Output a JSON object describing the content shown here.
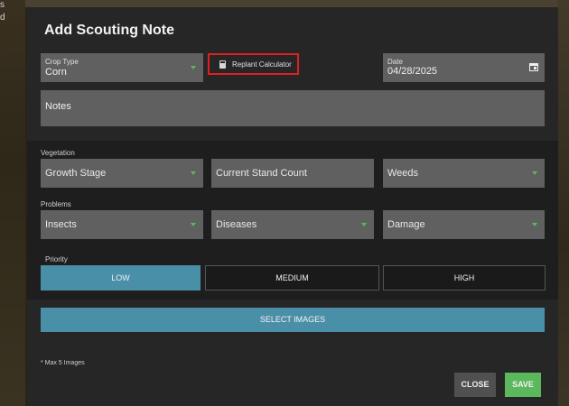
{
  "background": {
    "fragments": [
      "s",
      "d"
    ]
  },
  "dialog": {
    "title": "Add Scouting Note"
  },
  "crop_type": {
    "label": "Crop Type",
    "value": "Corn"
  },
  "replant_calculator": {
    "label": "Replant Calculator",
    "icon": "calculator-icon"
  },
  "date": {
    "label": "Date",
    "value": "04/28/2025",
    "icon": "calendar-icon"
  },
  "notes": {
    "placeholder": "Notes"
  },
  "vegetation": {
    "section_label": "Vegetation",
    "growth_stage": "Growth Stage",
    "current_stand_count": "Current Stand Count",
    "weeds": "Weeds"
  },
  "problems": {
    "section_label": "Problems",
    "insects": "Insects",
    "diseases": "Diseases",
    "damage": "Damage"
  },
  "priority": {
    "section_label": "Priority",
    "options": [
      "LOW",
      "MEDIUM",
      "HIGH"
    ],
    "selected": "LOW"
  },
  "images": {
    "select_label": "SELECT IMAGES",
    "max_note": "* Max 5 Images"
  },
  "actions": {
    "close_label": "CLOSE",
    "save_label": "SAVE"
  },
  "colors": {
    "accent_blue": "#4a8fa8",
    "save_green": "#5cb85c",
    "highlight_red": "#e02020"
  }
}
